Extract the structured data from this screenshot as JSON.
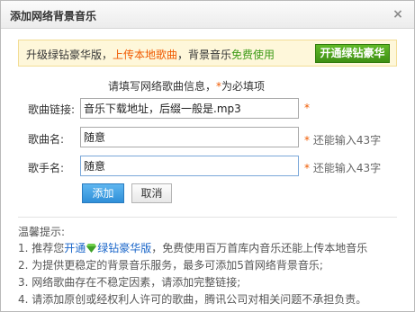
{
  "dialog": {
    "title": "添加网络背景音乐",
    "close_glyph": "×"
  },
  "banner": {
    "text_1": "升级绿钻豪华版，",
    "text_2": "上传本地歌曲",
    "text_3": "，背景音乐",
    "text_4": "免费使用",
    "button_label": "开通绿钻豪华"
  },
  "form": {
    "hint_text": "请填写网络歌曲信息，",
    "hint_star": "*",
    "hint_suffix": "为必填项",
    "song_link_label": "歌曲链接:",
    "song_link_value": "音乐下载地址，后缀一般是.mp3",
    "song_link_star": "*",
    "song_name_label": "歌曲名:",
    "song_name_value": "随意",
    "song_name_star": "*",
    "song_name_hint": "还能输入43字",
    "singer_label": "歌手名:",
    "singer_value": "随意",
    "singer_star": "*",
    "singer_hint": "还能输入43字",
    "add_button": "添加",
    "cancel_button": "取消"
  },
  "tips": {
    "title": "温馨提示:",
    "tip1_a": "1. 推荐您",
    "tip1_link": "开通",
    "tip1_link2": "绿钻豪华版",
    "tip1_b": "，免费使用百万首库内音乐还能上传本地音乐",
    "tip2": "2. 为提供更稳定的背景音乐服务，最多可添加5首网络背景音乐;",
    "tip3": "3. 网络歌曲存在不稳定因素，请添加完整链接;",
    "tip4": "4. 请添加原创或经权利人许可的歌曲，腾讯公司对相关问题不承担负责。"
  },
  "colors": {
    "accent_orange": "#f05a00",
    "vip_green": "#3f9014",
    "link_blue": "#1a66c9",
    "add_button_blue": "#2f8fd8"
  }
}
